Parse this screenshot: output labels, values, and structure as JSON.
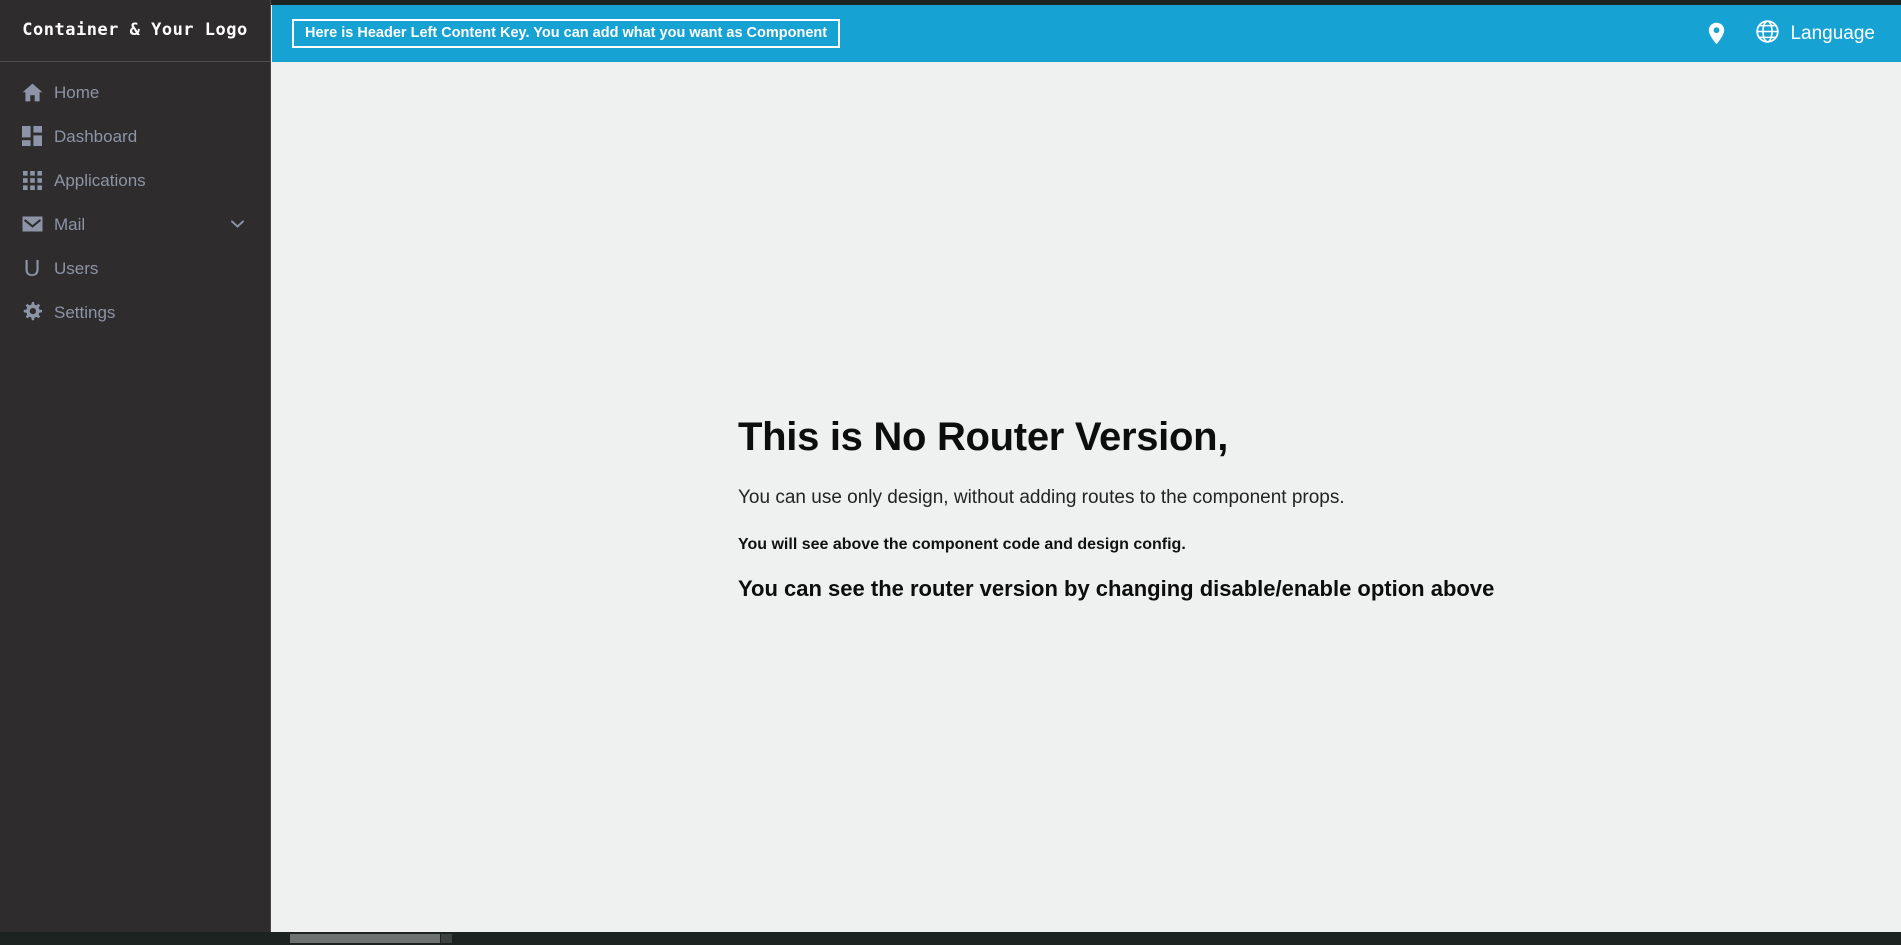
{
  "sidebar": {
    "logo": "Container & Your Logo",
    "items": [
      {
        "label": "Home",
        "icon": "home-icon",
        "expandable": false
      },
      {
        "label": "Dashboard",
        "icon": "dashboard-icon",
        "expandable": false
      },
      {
        "label": "Applications",
        "icon": "applications-icon",
        "expandable": false
      },
      {
        "label": "Mail",
        "icon": "mail-icon",
        "expandable": true
      },
      {
        "label": "Users",
        "icon": "users-letter-icon",
        "expandable": false,
        "glyph": "U"
      },
      {
        "label": "Settings",
        "icon": "gear-icon",
        "expandable": false
      }
    ]
  },
  "header": {
    "left_content_label": "Here is Header Left Content Key. You can add what you want as Component",
    "location_icon": "map-pin-icon",
    "language_icon": "globe-icon",
    "language_label": "Language"
  },
  "main": {
    "headline": "This is No Router Version,",
    "paragraph": "You can use only design, without adding routes to the component props.",
    "note": "You will see above the component code and design config.",
    "callout": "You can see the router version by changing disable/enable option above"
  },
  "colors": {
    "accent_blue": "#17a2d4",
    "sidebar_bg": "#2e2c2d",
    "sidebar_text": "#8c94a6",
    "content_bg": "#eff0f0"
  }
}
